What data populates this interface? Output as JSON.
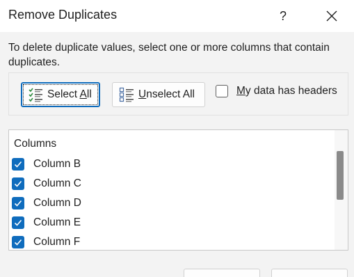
{
  "dialog": {
    "title": "Remove Duplicates",
    "help_label": "?",
    "description": "To delete duplicate values, select one or more columns that contain duplicates."
  },
  "buttons": {
    "select_all": {
      "accel": "Select ",
      "underlined": "A",
      "rest": "ll"
    },
    "unselect_all": {
      "underlined": "U",
      "rest": "nselect All"
    }
  },
  "headers_option": {
    "underlined": "M",
    "rest": "y data has headers",
    "checked": false
  },
  "columns_list": {
    "header": "Columns",
    "items": [
      {
        "label": "Column B",
        "checked": true
      },
      {
        "label": "Column C",
        "checked": true
      },
      {
        "label": "Column D",
        "checked": true
      },
      {
        "label": "Column E",
        "checked": true
      },
      {
        "label": "Column F",
        "checked": true
      }
    ]
  },
  "colors": {
    "accent": "#0f6cbd",
    "title_bar": "#ffffff",
    "dialog_bg": "#f3f3f3"
  },
  "icons": {
    "select_all": "select-all-list-icon",
    "unselect_all": "unselect-all-list-icon",
    "close": "close-icon",
    "check": "checkmark-icon"
  }
}
